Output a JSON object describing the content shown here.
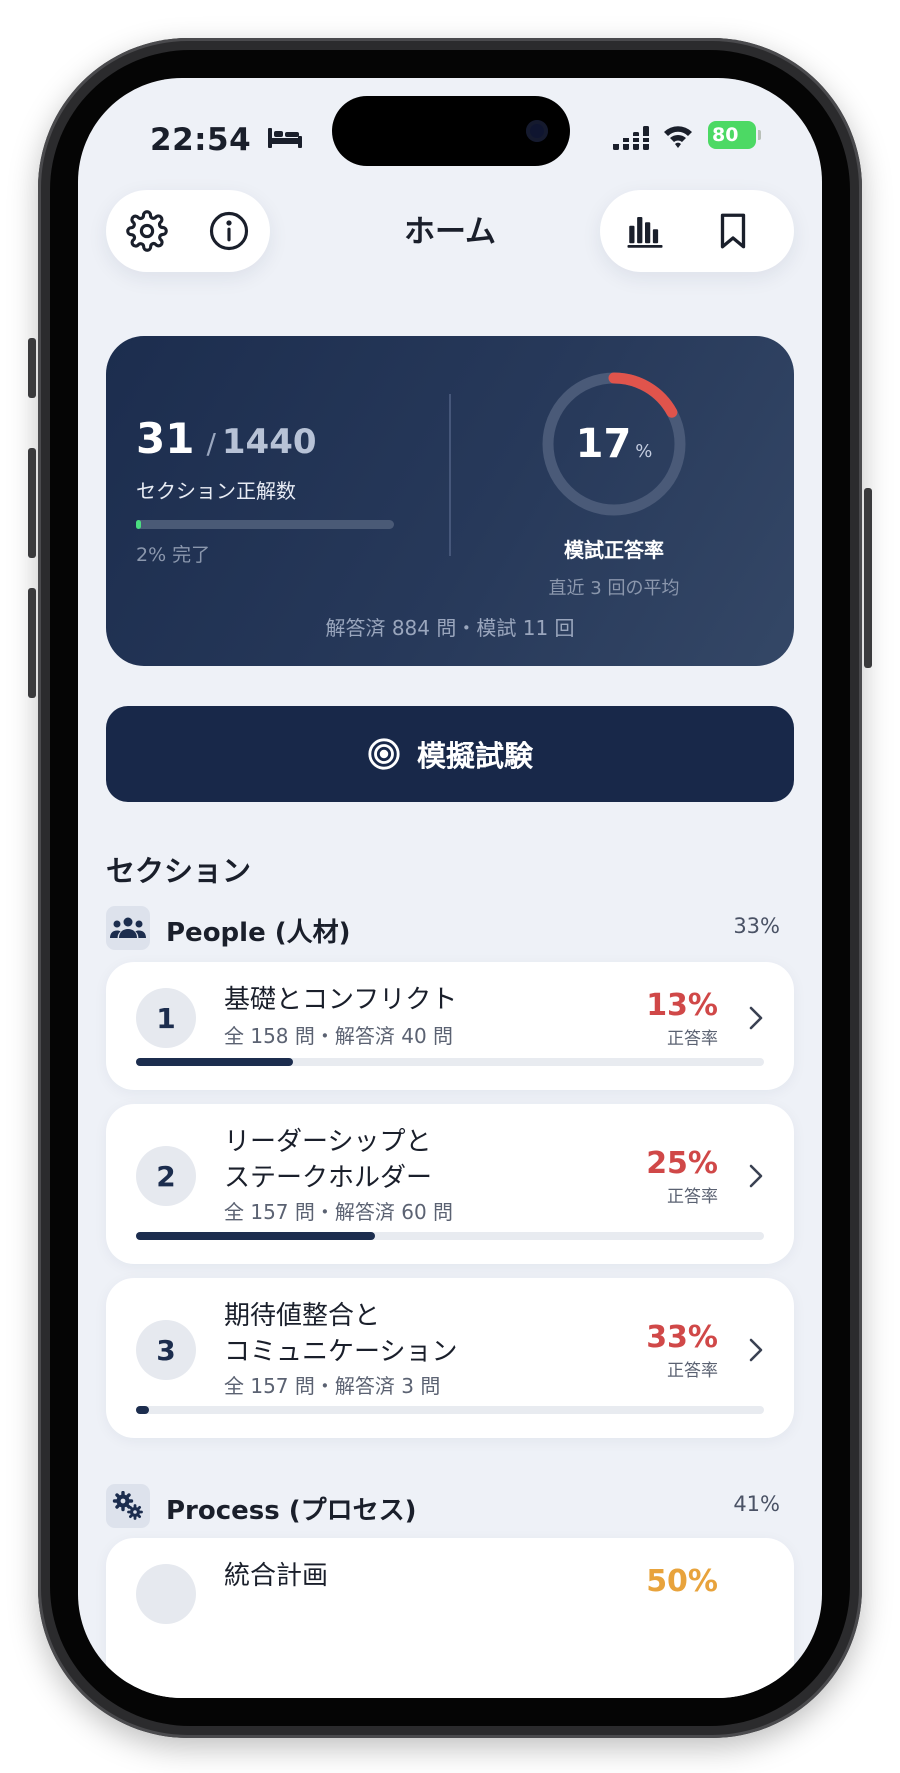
{
  "status_bar": {
    "time": "22:54",
    "battery": "80"
  },
  "header": {
    "title": "ホーム"
  },
  "stats": {
    "correct": "31",
    "separator": "/",
    "total": "1440",
    "label": "セクション正解数",
    "progress_fraction": 0.02,
    "progress_text": "2% 完了",
    "exam_rate_value": "17",
    "exam_rate_unit": "%",
    "exam_rate_fraction": 0.17,
    "exam_rate_label": "模試正答率",
    "exam_rate_note": "直近 3 回の平均",
    "footer": "解答済 884 問・模試 11 回"
  },
  "exam_button": {
    "label": "模擬試験"
  },
  "sections_heading": "セクション",
  "groups": [
    {
      "title": "People (人材)",
      "percent": "33%"
    },
    {
      "title": "Process (プロセス)",
      "percent": "41%"
    }
  ],
  "rows": [
    {
      "number": "1",
      "title_lines": [
        "基礎とコンフリクト"
      ],
      "meta": "全 158 問・解答済 40 問",
      "rate": "13%",
      "rate_label": "正答率",
      "progress_fraction": 0.25
    },
    {
      "number": "2",
      "title_lines": [
        "リーダーシップと",
        "ステークホルダー"
      ],
      "meta": "全 157 問・解答済 60 問",
      "rate": "25%",
      "rate_label": "正答率",
      "progress_fraction": 0.38
    },
    {
      "number": "3",
      "title_lines": [
        "期待値整合と",
        "コミュニケーション"
      ],
      "meta": "全 157 問・解答済 3 問",
      "rate": "33%",
      "rate_label": "正答率",
      "progress_fraction": 0.02
    },
    {
      "number": "",
      "title_lines": [
        "統合計画"
      ],
      "meta": "",
      "rate": "50%",
      "rate_label": "",
      "progress_fraction": 0
    }
  ],
  "colors": {
    "accent_navy": "#182849",
    "rate_red": "#d04848",
    "rate_orange": "#e8a33c",
    "ring_red": "#e0544c",
    "progress_green": "#4ade80"
  }
}
